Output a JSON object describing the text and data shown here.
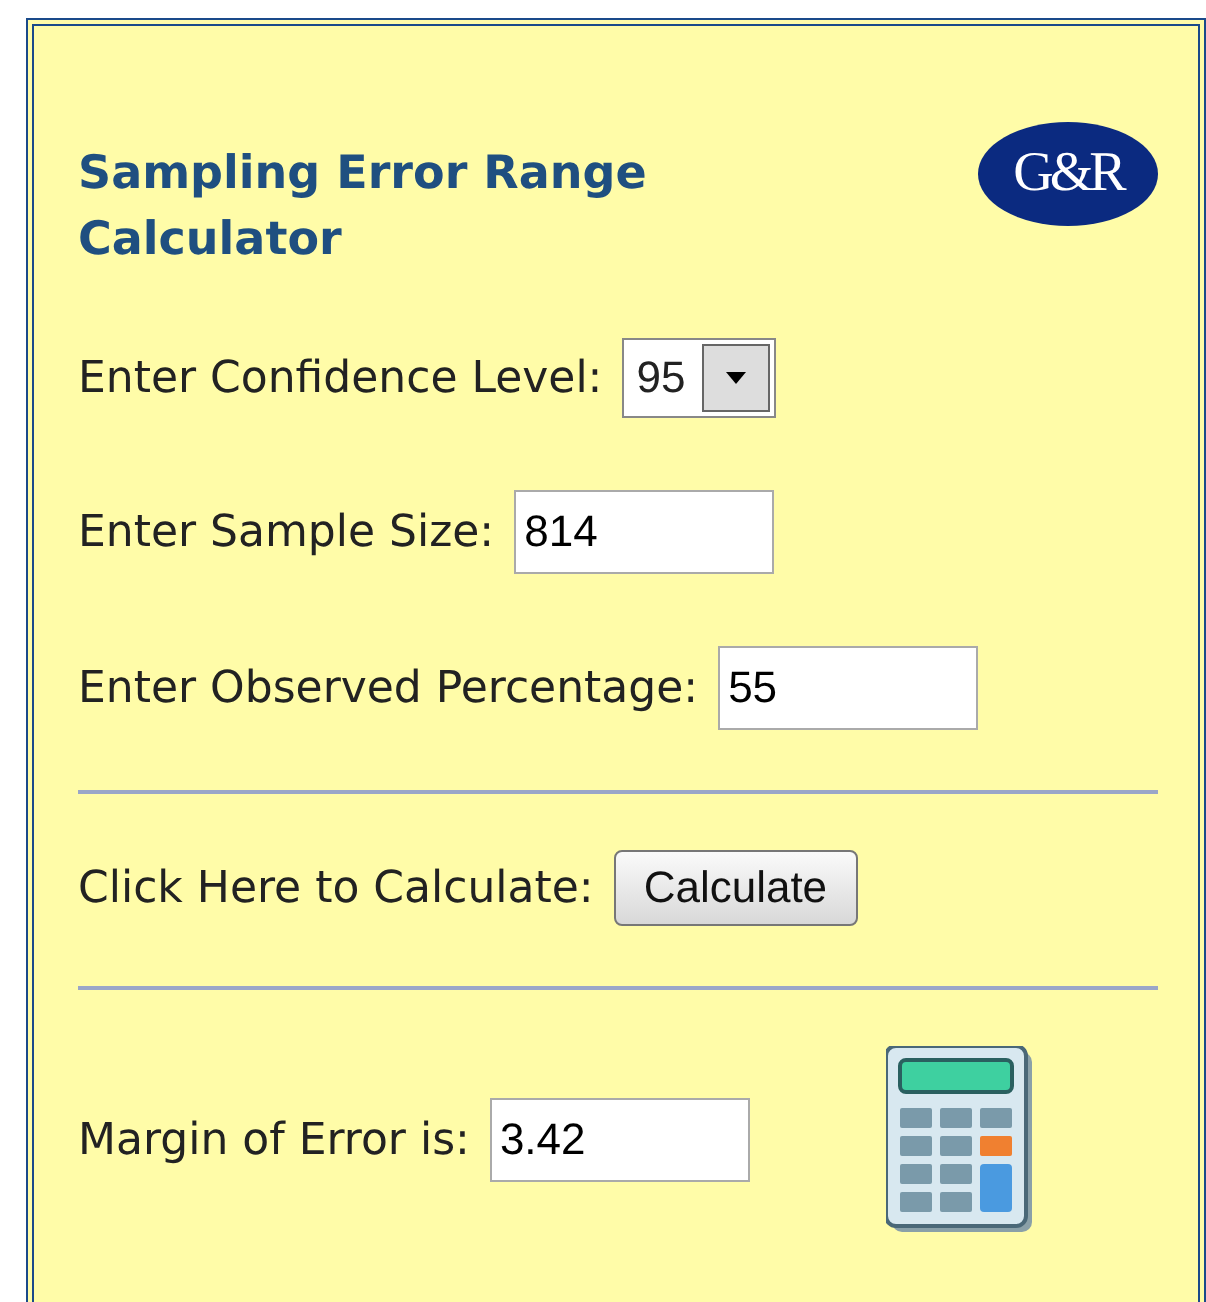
{
  "title": "Sampling Error Range Calculator",
  "logo": "G&R",
  "confidence": {
    "label": "Enter Confidence Level:",
    "value": "95"
  },
  "sample_size": {
    "label": "Enter Sample Size:",
    "value": "814"
  },
  "observed": {
    "label": "Enter Observed Percentage:",
    "value": "55"
  },
  "calculate": {
    "label": "Click Here to Calculate:",
    "button": "Calculate"
  },
  "result": {
    "label": "Margin of Error is:",
    "value": "3.42"
  }
}
